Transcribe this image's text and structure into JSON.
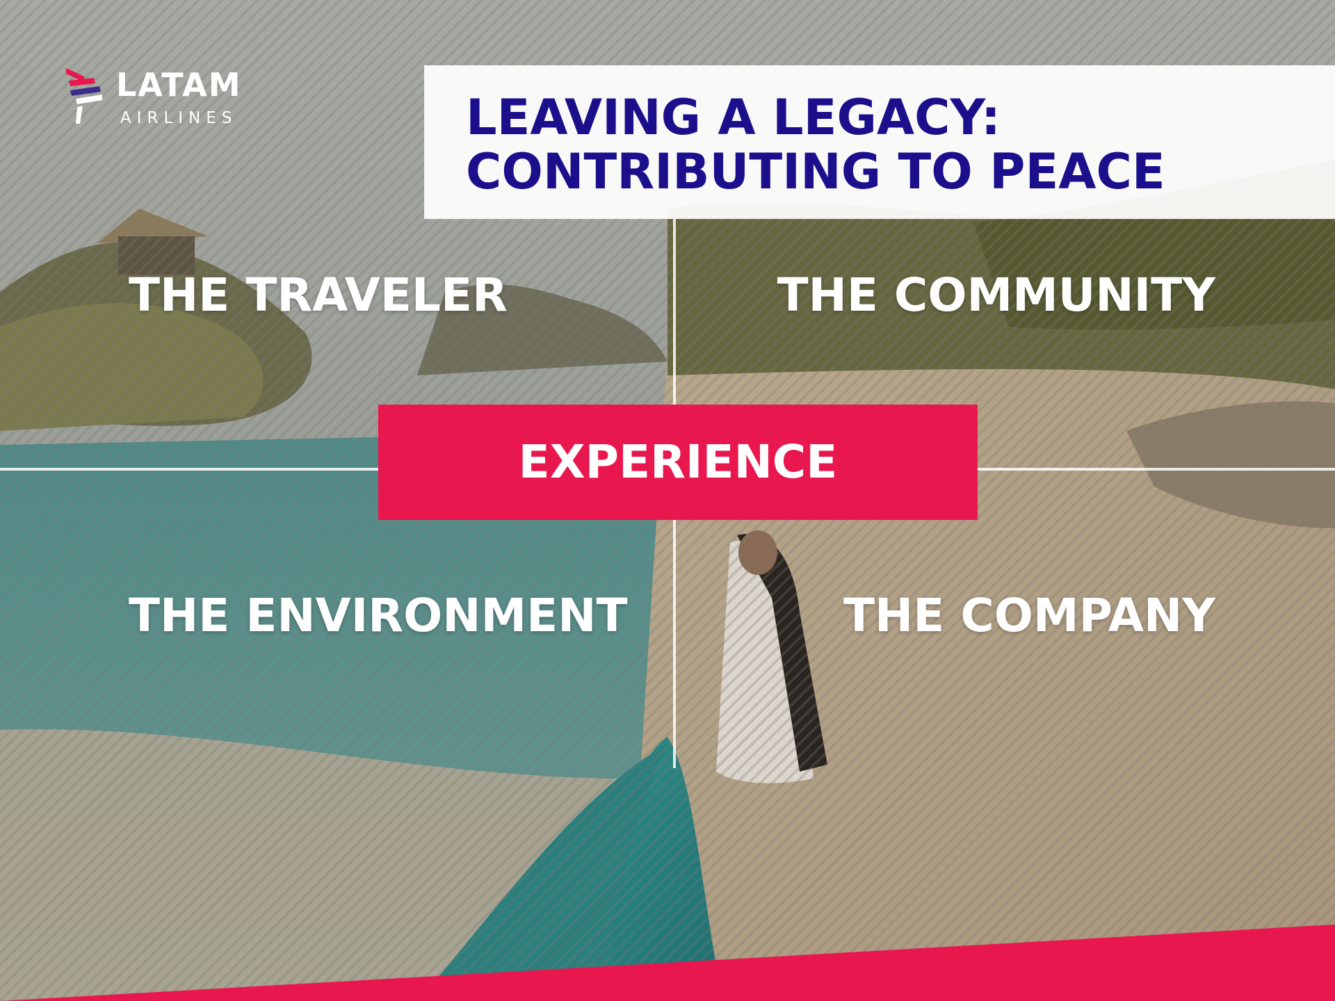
{
  "brand": {
    "name": "LATAM",
    "sub": "AIRLINES"
  },
  "title": {
    "line1": "LEAVING A LEGACY:",
    "line2": "CONTRIBUTING TO PEACE"
  },
  "quadrants": {
    "top_left": "THE TRAVELER",
    "top_right": "THE COMMUNITY",
    "bottom_left": "THE ENVIRONMENT",
    "bottom_right": "THE COMPANY"
  },
  "center": {
    "label": "EXPERIENCE"
  },
  "colors": {
    "accent": "#e8184f",
    "title_text": "#1b0f8c",
    "title_background": "#ffffff"
  }
}
